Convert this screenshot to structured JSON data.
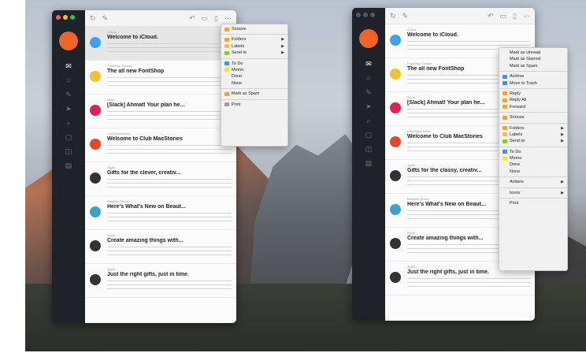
{
  "window1": {
    "messages": [
      {
        "from": "iCloud",
        "date": "",
        "subject": "Welcome to iCloud.",
        "icon": "cloud-icon",
        "icon_color": "#3fa0ef",
        "selected": true
      },
      {
        "from": "FontShop Games",
        "date": "",
        "subject": "The all new FontShop",
        "icon": "fontshop-logo",
        "icon_color": "#f2c230",
        "selected": false
      },
      {
        "from": "Slack",
        "date": "",
        "subject": "[Slack] Ahmat! Your plan he...",
        "icon": "slack-logo",
        "icon_color": "#e01e5a",
        "selected": false
      },
      {
        "from": "Club MacStories",
        "date": "",
        "subject": "Welcome to Club MacStories",
        "icon": "macstories-logo",
        "icon_color": "#e8452c",
        "selected": false
      },
      {
        "from": "Apple",
        "date": "",
        "subject": "Gifts for the clever, creativ...",
        "icon": "apple-logo",
        "icon_color": "#333333",
        "selected": false
      },
      {
        "from": "Beautiful Pixels",
        "date": "",
        "subject": "Here's What's New on Beaut...",
        "icon": "bp-logo",
        "icon_color": "#3aa3c9",
        "selected": false
      },
      {
        "from": "Apple",
        "date": "",
        "subject": "Create amazing things with...",
        "icon": "apple-logo",
        "icon_color": "#333333",
        "selected": false
      },
      {
        "from": "Apple",
        "date": "",
        "subject": "Just the right gifts, just in time.",
        "icon": "apple-logo",
        "icon_color": "#333333",
        "selected": false
      }
    ],
    "menu": [
      {
        "label": "Snooze",
        "color": "#f5a623"
      },
      {
        "sep": true
      },
      {
        "label": "Folders",
        "color": "#f5a623",
        "submenu": true
      },
      {
        "label": "Labels",
        "color": "#f5c342",
        "submenu": true
      },
      {
        "label": "Send to",
        "color": "#7ed321",
        "submenu": true
      },
      {
        "sep": true
      },
      {
        "label": "To Do",
        "color": "#4a90e2"
      },
      {
        "label": "Memo",
        "color": "#f8e71c"
      },
      {
        "label": "Done",
        "color": ""
      },
      {
        "label": "None",
        "color": ""
      },
      {
        "sep": true
      },
      {
        "label": "Mark as Spam",
        "color": "#f5a623"
      },
      {
        "sep": true
      },
      {
        "label": "Print",
        "color": "#9b9b9b"
      }
    ]
  },
  "window2": {
    "messages": [
      {
        "from": "iCloud",
        "date": "",
        "subject": "Welcome to iCloud.",
        "icon": "cloud-icon",
        "icon_color": "#3fa0ef",
        "selected": false
      },
      {
        "from": "FontShop Games",
        "date": "",
        "subject": "The all new FontShop",
        "icon": "fontshop-logo",
        "icon_color": "#f2c230",
        "selected": false
      },
      {
        "from": "Slack",
        "date": "",
        "subject": "[Slack] Ahmat! Your plan he...",
        "icon": "slack-logo",
        "icon_color": "#e01e5a",
        "selected": false
      },
      {
        "from": "Club MacStories",
        "date": "",
        "subject": "Welcome to Club MacStories",
        "icon": "macstories-logo",
        "icon_color": "#e8452c",
        "selected": false
      },
      {
        "from": "Apple",
        "date": "",
        "subject": "Gifts for the classy, creativ...",
        "icon": "apple-logo",
        "icon_color": "#333333",
        "selected": false
      },
      {
        "from": "Beautiful Pixels",
        "date": "",
        "subject": "Here's What's New on Beaut...",
        "icon": "bp-logo",
        "icon_color": "#3aa3c9",
        "selected": false
      },
      {
        "from": "Apple",
        "date": "",
        "subject": "Create amazing things with...",
        "icon": "apple-logo",
        "icon_color": "#333333",
        "selected": false
      },
      {
        "from": "Apple",
        "date": "",
        "subject": "Just the right gifts, just in time.",
        "icon": "apple-logo",
        "icon_color": "#333333",
        "selected": false
      }
    ],
    "menu": [
      {
        "label": "Mark as Unread",
        "color": ""
      },
      {
        "label": "Mark as Starred",
        "color": ""
      },
      {
        "label": "Mark as Spam",
        "color": ""
      },
      {
        "sep": true
      },
      {
        "label": "Archive",
        "color": "#4a90e2"
      },
      {
        "label": "Move to Trash",
        "color": "#4a90e2"
      },
      {
        "sep": true
      },
      {
        "label": "Reply",
        "color": "#f5a623"
      },
      {
        "label": "Reply All",
        "color": "#f5a623"
      },
      {
        "label": "Forward",
        "color": "#f5a623"
      },
      {
        "sep": true
      },
      {
        "label": "Snooze",
        "color": "#f5a623"
      },
      {
        "sep": true
      },
      {
        "label": "Folders",
        "color": "#f5a623",
        "submenu": true
      },
      {
        "label": "Labels",
        "color": "#f5c342",
        "submenu": true
      },
      {
        "label": "Send to",
        "color": "#7ed321",
        "submenu": true
      },
      {
        "sep": true
      },
      {
        "label": "To Do",
        "color": "#4a90e2"
      },
      {
        "label": "Memo",
        "color": "#f8e71c"
      },
      {
        "label": "Done",
        "color": ""
      },
      {
        "label": "None",
        "color": ""
      },
      {
        "sep": true
      },
      {
        "label": "Actions",
        "color": "",
        "submenu": true
      },
      {
        "sep": true
      },
      {
        "label": "Icons",
        "color": "",
        "submenu": true
      },
      {
        "sep": true
      },
      {
        "label": "Print",
        "color": ""
      }
    ]
  }
}
